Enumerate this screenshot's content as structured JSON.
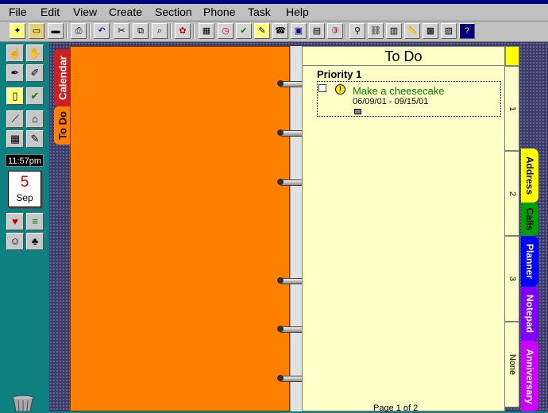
{
  "menubar": {
    "items": [
      "File",
      "Edit",
      "View",
      "Create",
      "Section",
      "Phone",
      "Task",
      "Help"
    ]
  },
  "palette": {
    "clock": "11:57pm",
    "calendar_day": "5",
    "calendar_month": "Sep"
  },
  "left_tabs": {
    "calendar": "Calendar",
    "todo": "To Do"
  },
  "page": {
    "header": "To Do",
    "priority_title": "Priority 1",
    "task": {
      "title": "Make a cheesecake",
      "dates": "06/09/01 - 09/15/01",
      "priority_mark": "!"
    },
    "pager": "Page 1 of 2"
  },
  "priority_sections": [
    "1",
    "2",
    "3",
    "None"
  ],
  "right_tabs": [
    {
      "label": "Address",
      "color": "#ffff00",
      "text_color": "#000080"
    },
    {
      "label": "Calls",
      "color": "#00a000",
      "text_color": "#000000"
    },
    {
      "label": "Planner",
      "color": "#0000ff",
      "text_color": "#ffffff"
    },
    {
      "label": "Notepad",
      "color": "#8000ff",
      "text_color": "#ffffff"
    },
    {
      "label": "Anniversary",
      "color": "#cc00ff",
      "text_color": "#ffffff"
    }
  ],
  "colors": {
    "left_page": "#ff8000",
    "right_page": "#ffffc8",
    "desktop": "#0f8080"
  }
}
